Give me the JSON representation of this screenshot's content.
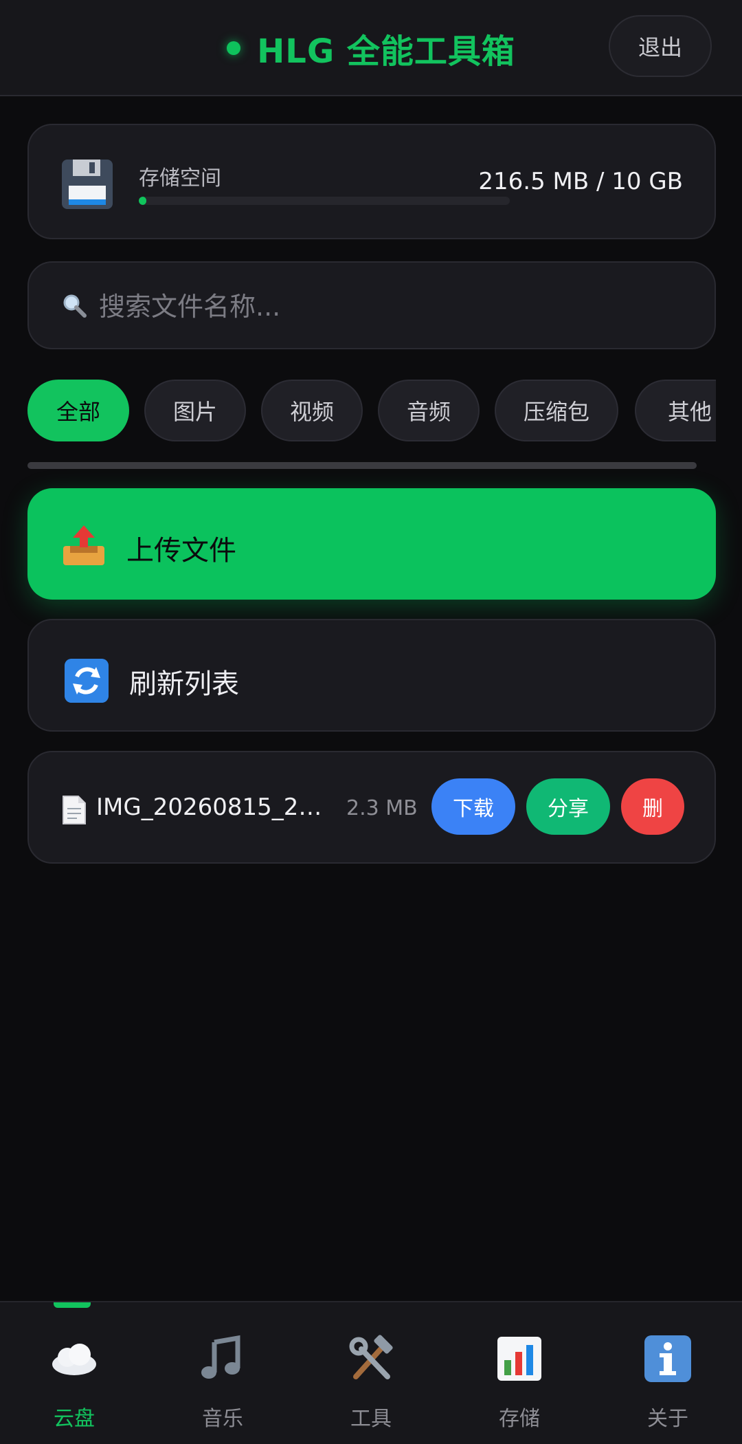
{
  "header": {
    "title": "HLG 全能工具箱",
    "logout_label": "退出",
    "accent_color": "#12c35e"
  },
  "storage": {
    "icon": "floppy-disk-icon",
    "label": "存储空间",
    "usage_text": "216.5 MB / 10 GB",
    "used_fraction": 0.021
  },
  "search": {
    "icon": "magnifier-icon",
    "placeholder": "搜索文件名称..."
  },
  "filters": {
    "selected": "全部",
    "items": [
      {
        "label": "全部"
      },
      {
        "label": "图片"
      },
      {
        "label": "视频"
      },
      {
        "label": "音频"
      },
      {
        "label": "压缩包"
      },
      {
        "label": "其他"
      }
    ]
  },
  "actions": {
    "upload_label": "上传文件",
    "upload_icon": "outbox-tray-icon",
    "refresh_label": "刷新列表",
    "refresh_icon": "refresh-arrows-icon"
  },
  "files": [
    {
      "icon": "document-icon",
      "name": "IMG_20260815_2…",
      "size": "2.3 MB",
      "download_label": "下载",
      "share_label": "分享",
      "delete_label": "删"
    }
  ],
  "bottom_nav": {
    "items": [
      {
        "label": "云盘",
        "icon": "cloud-icon",
        "active": true
      },
      {
        "label": "音乐",
        "icon": "music-note-icon",
        "active": false
      },
      {
        "label": "工具",
        "icon": "hammer-wrench-icon",
        "active": false
      },
      {
        "label": "存储",
        "icon": "bar-chart-icon",
        "active": false
      },
      {
        "label": "关于",
        "icon": "info-icon",
        "active": false
      }
    ]
  },
  "colors": {
    "background": "#0c0c0e",
    "card": "#1a1a1f",
    "green": "#0bc25d",
    "blue": "#3b82f6",
    "teal": "#10b874",
    "red": "#ef4444"
  }
}
